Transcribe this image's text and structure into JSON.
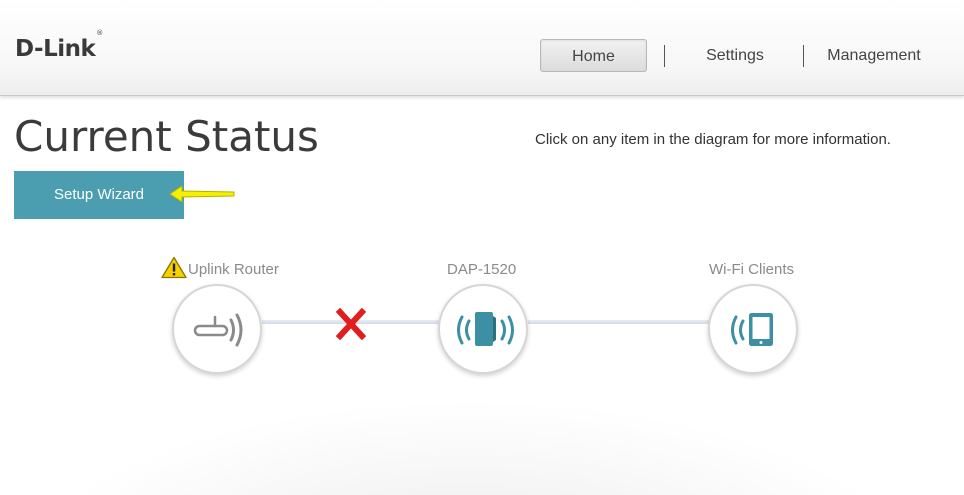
{
  "brand": {
    "name": "D-Link",
    "mark": "®"
  },
  "nav": {
    "home": "Home",
    "settings": "Settings",
    "management": "Management"
  },
  "page": {
    "title": "Current Status",
    "hint": "Click on any item in the diagram for more information.",
    "setup_wizard": "Setup Wizard"
  },
  "diagram": {
    "uplink": {
      "label": "Uplink Router",
      "icon": "router-icon",
      "status": "warning"
    },
    "device": {
      "label": "DAP-1520",
      "icon": "extender-icon"
    },
    "clients": {
      "label": "Wi-Fi Clients",
      "icon": "tablet-icon"
    },
    "link_uplink": {
      "status": "disconnected",
      "icon": "x-icon"
    }
  },
  "colors": {
    "accent": "#4a9eaf",
    "wizard_button": "#4a9eaf",
    "disconnect": "#e01e1e",
    "warning": "#f3d200",
    "arrow": "#f5f000",
    "icon_gray": "#8a8a8a"
  }
}
